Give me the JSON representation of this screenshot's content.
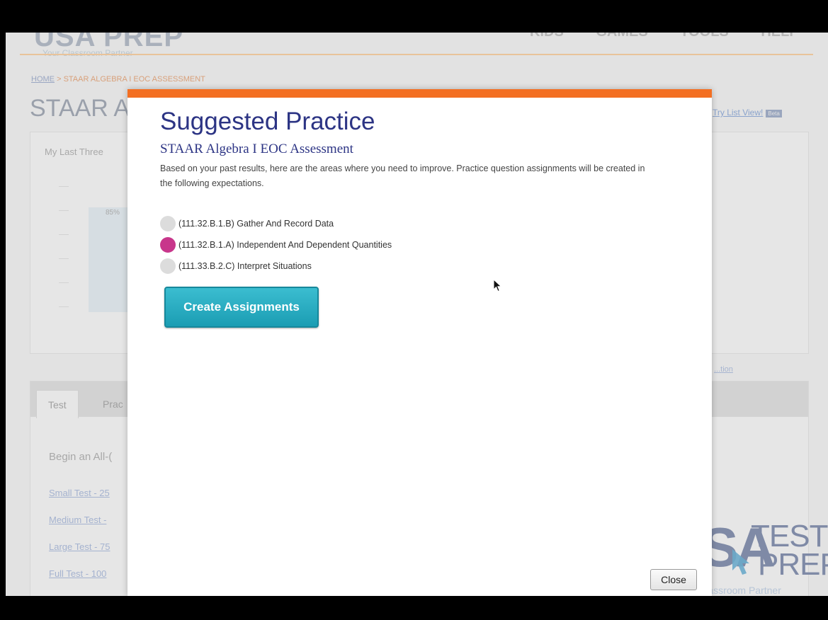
{
  "background_page": {
    "logo_text": "USA PREP",
    "logo_tagline": "Your Classroom Partner",
    "nav_text": "KIDS GAMES TOOLS HELP",
    "breadcrumb": {
      "home": "HOME",
      "separator": ">",
      "current": "STAAR ALGEBRA I EOC ASSESSMENT"
    },
    "page_title": "STAAR A",
    "try_list_view": "Try List View!",
    "try_list_badge": "Beta",
    "panel_label": "My Last Three",
    "chart_bar_label": "85%",
    "right_link": "...tion",
    "tabs": [
      "Test",
      "Prac"
    ],
    "begin_text": "Begin an All-(",
    "test_links": [
      "Small Test - 25",
      "Medium Test -",
      "Large Test - 75",
      "Full Test - 100"
    ]
  },
  "watermark": {
    "usa": "USA",
    "test": "TEST",
    "prep": "PREP",
    "tagline": "Your Classroom Partner"
  },
  "modal": {
    "title": "Suggested Practice",
    "subtitle": "STAAR Algebra I EOC Assessment",
    "description": "Based on your past results, here are the areas where you need to improve. Practice question assignments will be created in the following expectations.",
    "items": [
      {
        "label": "(111.32.B.1.B) Gather And Record Data",
        "selected": false
      },
      {
        "label": "(111.32.B.1.A) Independent And Dependent Quantities",
        "selected": true
      },
      {
        "label": "(111.33.B.2.C) Interpret Situations",
        "selected": false
      }
    ],
    "create_button": "Create Assignments",
    "close_button": "Close"
  },
  "colors": {
    "modal_accent": "#f36f22",
    "title_blue": "#2c3484",
    "button_teal": "#1b9db3",
    "selected_dot": "#c8368b",
    "unselected_dot": "#dcdcdc"
  }
}
